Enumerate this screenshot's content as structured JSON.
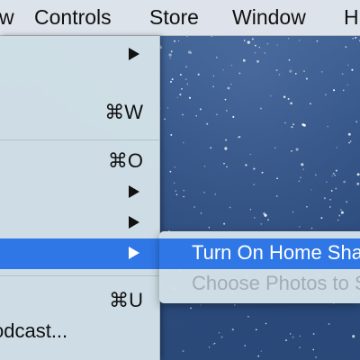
{
  "menubar": {
    "items": [
      {
        "label": "w"
      },
      {
        "label": "Controls"
      },
      {
        "label": "Store"
      },
      {
        "label": "Window"
      },
      {
        "label": "H"
      }
    ]
  },
  "menu": {
    "items": [
      {
        "shortcut": "",
        "has_submenu": true
      },
      {
        "shortcut": "⌘W",
        "has_submenu": false
      },
      {
        "shortcut": "⌘O",
        "has_submenu": false
      },
      {
        "shortcut": "",
        "has_submenu": true
      },
      {
        "shortcut": "",
        "has_submenu": true
      },
      {
        "shortcut": "",
        "has_submenu": true,
        "selected": true
      },
      {
        "shortcut": "⌘U",
        "has_submenu": false
      },
      {
        "label": "odcast...",
        "shortcut": ""
      }
    ]
  },
  "submenu": {
    "items": [
      {
        "label": "Turn On Home Sharing",
        "selected": true
      },
      {
        "label": "Choose Photos to Share...",
        "disabled": true
      }
    ]
  }
}
